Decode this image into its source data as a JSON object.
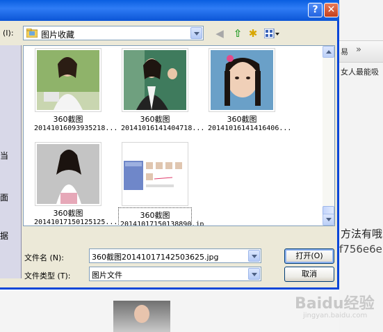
{
  "background": {
    "tab_label": "易",
    "line1": "女人最能吸",
    "line2": "方法有哦",
    "line3": "f756e6e",
    "watermark": "Baidu经验",
    "watermark_sub": "jingyan.baidu.com"
  },
  "dialog": {
    "help_label": "?",
    "close_label": "✕",
    "lookin_label": "(I):",
    "lookin_value": "图片收藏",
    "places": [
      "当",
      "面",
      "据"
    ],
    "thumbnails": [
      {
        "line1": "360截图",
        "line2": "20141016093935218...",
        "selected": false
      },
      {
        "line1": "360截图",
        "line2": "20141016141404718...",
        "selected": false
      },
      {
        "line1": "360截图",
        "line2": "20141016141416406...",
        "selected": false
      },
      {
        "line1": "360截图",
        "line2": "20141017150125125...",
        "selected": false
      },
      {
        "line1": "360截图",
        "line2": "20141017150138890.jp",
        "line3": "g",
        "selected": true
      }
    ],
    "filename_label": "文件名 (N):",
    "filename_value": "360截图20141017142503625.jpg",
    "filetype_label": "文件类型 (T):",
    "filetype_value": "图片文件",
    "open_label": "打开(O)",
    "cancel_label": "取消"
  }
}
